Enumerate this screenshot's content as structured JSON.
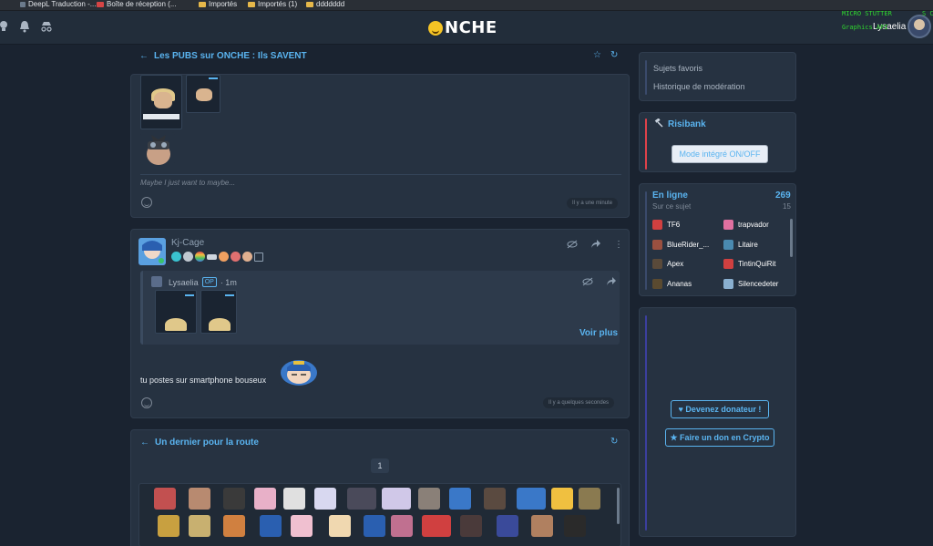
{
  "browser": {
    "bookmarks": [
      {
        "label": "DeepL Traduction -...",
        "icon": "play-icon"
      },
      {
        "label": "Boîte de réception (...",
        "icon": "gmail-icon"
      },
      {
        "label": "Importés",
        "icon": "folder-icon"
      },
      {
        "label": "Importés (1)",
        "icon": "folder-icon"
      },
      {
        "label": "ddddddd",
        "icon": "folder-icon"
      }
    ],
    "overlay": {
      "line1": "MICRO STUTTER",
      "line2": "Graphics API",
      "line3": "S CO"
    }
  },
  "topbar": {
    "logo_text": "NCHE",
    "username": "Lysaelia",
    "icons": [
      "lightbulb-icon",
      "bell-icon",
      "spy-icon"
    ]
  },
  "thread1": {
    "title": "Les PUBS sur ONCHE : Ils SAVENT",
    "post": {
      "caption": "Maybe I just want to maybe...",
      "time": "Il y a une minute"
    }
  },
  "post2": {
    "username": "Kj-Cage",
    "quote": {
      "author": "Lysaelia",
      "op": "OP",
      "age": "· 1m",
      "voir_plus": "Voir plus"
    },
    "text": "tu postes sur smartphone bouseux",
    "time": "Il y a quelques secondes"
  },
  "thread2": {
    "title": "Un dernier pour la route",
    "page": "1"
  },
  "sidebar": {
    "links": [
      "Sujets favoris",
      "Historique de modération"
    ],
    "risibank": {
      "title": "Risibank",
      "toggle_label": "Mode intégré ON/OFF"
    },
    "online": {
      "title": "En ligne",
      "count": "269",
      "subject_label": "Sur ce sujet",
      "subject_count": "15",
      "users": [
        "TF6",
        "trapvador",
        "BlueRider_...",
        "Litaire",
        "Apex",
        "TintinQuiRit",
        "Ananas",
        "Silencedeter"
      ]
    },
    "donate": {
      "donor_label": "Devenez donateur !",
      "crypto_label": "Faire un don en Crypto"
    }
  },
  "colors": {
    "accent": "#5ab4f0",
    "background": "#1a2330",
    "card": "#263241",
    "risibank_accent": "#e0424a",
    "online_accent": "#3a4a6b",
    "donate_accent": "#3b3f9e"
  }
}
